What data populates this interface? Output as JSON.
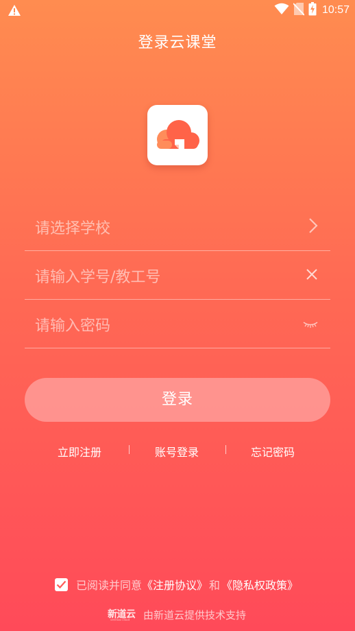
{
  "status_bar": {
    "time": "10:57",
    "icons": [
      "warning-icon",
      "wifi-icon",
      "no-sim-icon",
      "battery-charging-icon"
    ]
  },
  "header": {
    "title": "登录云课堂"
  },
  "logo": {
    "icon": "cloud-logo-icon",
    "colors": {
      "primary": "#FF6348",
      "secondary": "#FF8C5A"
    }
  },
  "form": {
    "school": {
      "placeholder": "请选择学校",
      "icon": "chevron-right-icon"
    },
    "account": {
      "placeholder": "请输入学号/教工号",
      "icon": "clear-icon"
    },
    "password": {
      "placeholder": "请输入密码",
      "icon": "eye-closed-icon"
    }
  },
  "login_button": {
    "label": "登录"
  },
  "links": {
    "register": "立即注册",
    "account_login": "账号登录",
    "forgot_password": "忘记密码"
  },
  "agreement": {
    "checked": true,
    "prefix": "已阅读并同意",
    "terms_link": "《注册协议》",
    "and": "和",
    "privacy_link": "《隐私权政策》"
  },
  "footer": {
    "logo_text": "新道云",
    "logo_subtext": "seentao cloud",
    "text": "由新道云提供技术支持"
  },
  "colors": {
    "gradient_top": "#FF8C50",
    "gradient_bottom": "#FF4A59",
    "button_bg": "#FFBEBE"
  }
}
